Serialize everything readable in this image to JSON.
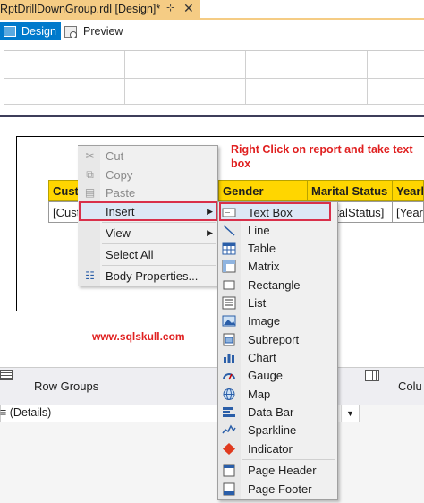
{
  "document_tab": {
    "title": "RptDrillDownGroup.rdl [Design]*",
    "pin_glyph": "⊹",
    "close_glyph": "✕"
  },
  "toolbar": {
    "design_label": "Design",
    "preview_label": "Preview"
  },
  "report": {
    "headers": [
      "Cust",
      "Gender",
      "Marital Status",
      "Yearl"
    ],
    "cells": [
      "[Cust",
      "",
      "",
      "ritalStatus]",
      "[Year"
    ],
    "annotation": "Right Click on report and take text box",
    "site": "www.sqlskull.com"
  },
  "context_menu": {
    "items": [
      {
        "label": "Cut",
        "icon": "cut-icon",
        "glyph": "✂",
        "enabled": false
      },
      {
        "label": "Copy",
        "icon": "copy-icon",
        "glyph": "⧉",
        "enabled": false
      },
      {
        "label": "Paste",
        "icon": "paste-icon",
        "glyph": "▤",
        "enabled": false
      },
      {
        "label": "Insert",
        "icon": "",
        "glyph": "",
        "enabled": true,
        "submenu": true
      },
      {
        "label": "View",
        "icon": "",
        "glyph": "",
        "enabled": true,
        "submenu": true
      },
      {
        "label": "Select All",
        "icon": "",
        "glyph": "",
        "enabled": true
      },
      {
        "label": "Body Properties...",
        "icon": "properties-icon",
        "glyph": "☷",
        "enabled": true
      }
    ],
    "arrow_glyph": "▶"
  },
  "insert_submenu": {
    "items": [
      {
        "label": "Text Box",
        "icon": "textbox-icon"
      },
      {
        "label": "Line",
        "icon": "line-icon"
      },
      {
        "label": "Table",
        "icon": "table-icon"
      },
      {
        "label": "Matrix",
        "icon": "matrix-icon"
      },
      {
        "label": "Rectangle",
        "icon": "rectangle-icon"
      },
      {
        "label": "List",
        "icon": "list-icon"
      },
      {
        "label": "Image",
        "icon": "image-icon"
      },
      {
        "label": "Subreport",
        "icon": "subreport-icon"
      },
      {
        "label": "Chart",
        "icon": "chart-icon"
      },
      {
        "label": "Gauge",
        "icon": "gauge-icon"
      },
      {
        "label": "Map",
        "icon": "map-icon"
      },
      {
        "label": "Data Bar",
        "icon": "databar-icon"
      },
      {
        "label": "Sparkline",
        "icon": "sparkline-icon"
      },
      {
        "label": "Indicator",
        "icon": "indicator-icon"
      },
      {
        "label": "Page Header",
        "icon": "page-header-icon"
      },
      {
        "label": "Page Footer",
        "icon": "page-footer-icon"
      }
    ]
  },
  "groups": {
    "row_title": "Row Groups",
    "column_title": "Colu",
    "details_label": "≡ (Details)",
    "dropdown_glyph": "▼"
  },
  "colors": {
    "accent": "#007acc",
    "tab": "#f5cc84",
    "header_fill": "#ffd600",
    "annotation": "#e02020",
    "highlight_border": "#d9304a"
  }
}
